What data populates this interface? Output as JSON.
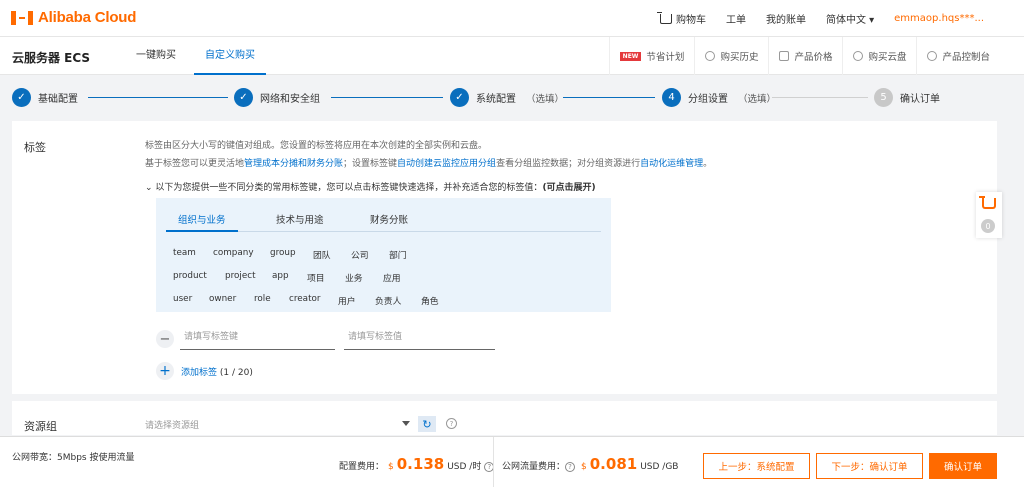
{
  "header": {
    "logo_text": "Alibaba Cloud",
    "nav": {
      "cart": "购物车",
      "ticket": "工单",
      "bill": "我的账单",
      "lang": "简体中文 ▾",
      "user": "emmaop.hqs***..."
    }
  },
  "subheader": {
    "product_title": "云服务器 ECS",
    "tabs": [
      "一键购买",
      "自定义购买"
    ],
    "active_tab": "自定义购买",
    "links": {
      "new_badge": "NEW",
      "saving_plan": "节省计划",
      "history": "购买历史",
      "price": "产品价格",
      "disk": "购买云盘",
      "console": "产品控制台"
    }
  },
  "steps": [
    {
      "label": "基础配置",
      "optional": "",
      "state": "done"
    },
    {
      "label": "网络和安全组",
      "optional": "",
      "state": "done"
    },
    {
      "label": "系统配置",
      "optional": "（选填）",
      "state": "done"
    },
    {
      "label": "分组设置",
      "optional": "（选填）",
      "state": "active",
      "num": "4"
    },
    {
      "label": "确认订单",
      "optional": "",
      "state": "pending",
      "num": "5"
    }
  ],
  "tags": {
    "label": "标签",
    "desc1": "标签由区分大小写的键值对组成。您设置的标签将应用在本次创建的全部实例和云盘。",
    "desc2_a": "基于标签您可以更灵活地",
    "desc2_link1": "管理成本分摊和财务分账",
    "desc2_b": "；设置标签键",
    "desc2_link2": "自动创建云监控应用分组",
    "desc2_c": "查看分组监控数据；对分组资源进行",
    "desc2_link3": "自动化运维管理",
    "desc2_d": "。",
    "expand_text": "以下为您提供一些不同分类的常用标签键，您可以点击标签键快速选择，并补充适合您的标签值：",
    "expand_strong": "(可点击展开)",
    "panel_tabs": [
      "组织与业务",
      "技术与用途",
      "财务分账"
    ],
    "keywords_row1": [
      "team",
      "company",
      "group",
      "团队",
      "公司",
      "部门"
    ],
    "keywords_row2": [
      "product",
      "project",
      "app",
      "项目",
      "业务",
      "应用"
    ],
    "keywords_row3": [
      "user",
      "owner",
      "role",
      "creator",
      "用户",
      "负责人",
      "角色"
    ],
    "key_placeholder": "请填写标签键",
    "value_placeholder": "请填写标签值",
    "add_label": "添加标签",
    "add_count": "(1 / 20)"
  },
  "resource_group": {
    "label": "资源组",
    "placeholder": "请选择资源组",
    "help": "?"
  },
  "cart_float": {
    "count": "0"
  },
  "footer": {
    "bandwidth": "公网带宽：5Mbps 按使用流量",
    "config_fee_label": "配置费用：",
    "config_fee_currency": "$",
    "config_fee_value": "0.138",
    "config_fee_unit": "USD /时",
    "traffic_fee_label": "公网流量费用：",
    "traffic_fee_currency": "$",
    "traffic_fee_value": "0.081",
    "traffic_fee_unit": "USD /GB",
    "btn_prev": "上一步：系统配置",
    "btn_next": "下一步：确认订单",
    "btn_confirm": "确认订单"
  },
  "colors": {
    "accent": "#ff6a00",
    "primary_blue": "#0070cc",
    "step_blue": "#0a6ebd"
  }
}
